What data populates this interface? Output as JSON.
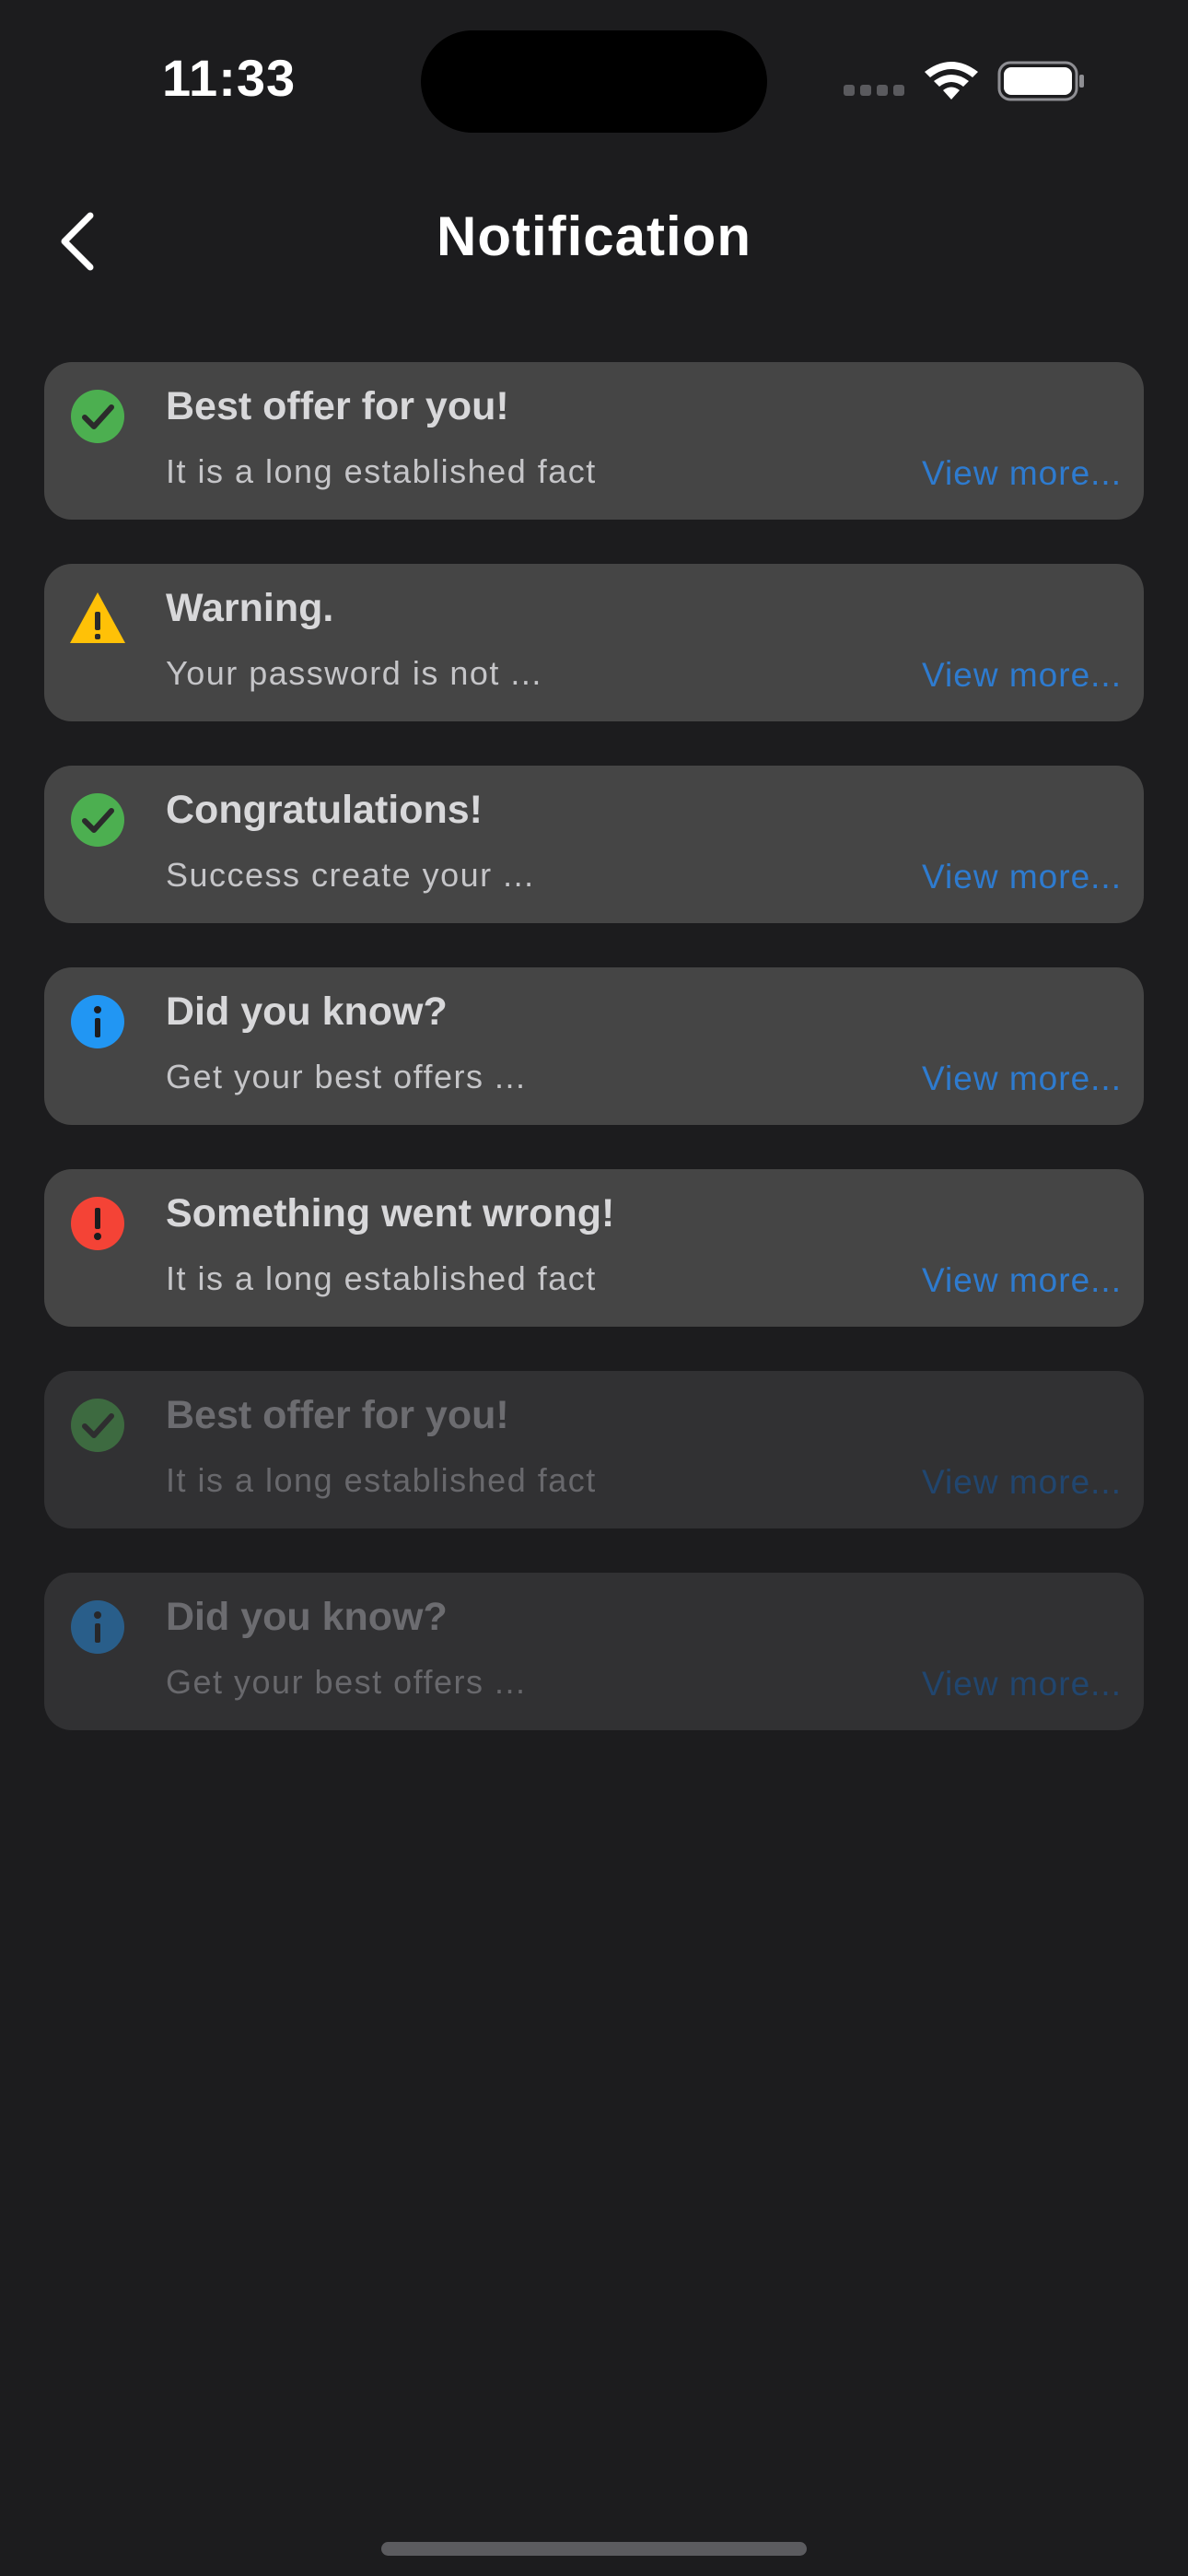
{
  "status_bar": {
    "time": "11:33"
  },
  "header": {
    "title": "Notification"
  },
  "notifications": [
    {
      "type": "success",
      "title": "Best offer for you!",
      "message": "It is a long established fact",
      "link": "View more...",
      "read": false
    },
    {
      "type": "warning",
      "title": "Warning.",
      "message": "Your password is not ...",
      "link": "View more...",
      "read": false
    },
    {
      "type": "success",
      "title": "Congratulations!",
      "message": "Success create your ...",
      "link": "View more...",
      "read": false
    },
    {
      "type": "info",
      "title": "Did you know?",
      "message": "Get your best offers ...",
      "link": "View more...",
      "read": false
    },
    {
      "type": "error",
      "title": "Something went wrong!",
      "message": "It is a long established fact",
      "link": "View more...",
      "read": false
    },
    {
      "type": "success",
      "title": "Best offer for you!",
      "message": "It is a long established fact",
      "link": "View more...",
      "read": true
    },
    {
      "type": "info",
      "title": "Did you know?",
      "message": "Get your best offers ...",
      "link": "View more...",
      "read": true
    }
  ],
  "icons": {
    "success": "check-circle-icon",
    "warning": "warning-triangle-icon",
    "info": "info-circle-icon",
    "error": "error-circle-icon"
  },
  "colors": {
    "background": "#1c1c1e",
    "card": "#454545",
    "card_read": "#313133",
    "link": "#2e7bcf",
    "success": "#4caf50",
    "warning": "#ffc107",
    "info": "#2196f3",
    "error": "#f44336"
  }
}
